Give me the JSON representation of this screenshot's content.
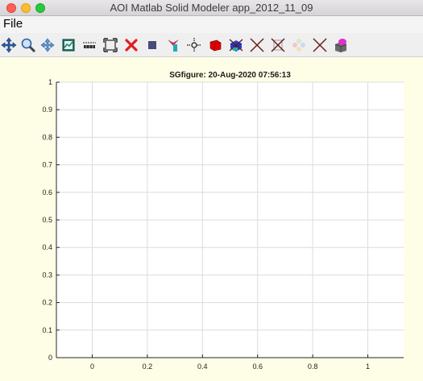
{
  "window": {
    "title": "AOI Matlab Solid Modeler app_2012_11_09"
  },
  "menu": {
    "file_label": "File"
  },
  "toolbar": {
    "tools": [
      {
        "name": "pan-arrows-icon"
      },
      {
        "name": "zoom-icon"
      },
      {
        "name": "move-icon"
      },
      {
        "name": "plot-icon"
      },
      {
        "name": "measure-icon"
      },
      {
        "name": "fit-view-icon"
      },
      {
        "name": "delete-icon"
      },
      {
        "name": "stop-icon"
      },
      {
        "name": "select-icon"
      },
      {
        "name": "crosshair-icon"
      },
      {
        "name": "red-solid-icon"
      },
      {
        "name": "blue-solid-icon"
      },
      {
        "name": "cross-tool-icon"
      },
      {
        "name": "crossed-frame-icon"
      },
      {
        "name": "dots-icon"
      },
      {
        "name": "cross-tool-2-icon"
      },
      {
        "name": "pink-solid-icon"
      }
    ]
  },
  "chart_data": {
    "type": "line",
    "title": "SGfigure: 20-Aug-2020 07:56:13",
    "xlim": [
      -0.13,
      1.13
    ],
    "ylim": [
      0,
      1
    ],
    "xticks": [
      "0",
      "0.2",
      "0.4",
      "0.6",
      "0.8",
      "1"
    ],
    "xtick_values": [
      0,
      0.2,
      0.4,
      0.6,
      0.8,
      1
    ],
    "yticks": [
      "0",
      "0.1",
      "0.2",
      "0.3",
      "0.4",
      "0.5",
      "0.6",
      "0.7",
      "0.8",
      "0.9",
      "1"
    ],
    "ytick_values": [
      0,
      0.1,
      0.2,
      0.3,
      0.4,
      0.5,
      0.6,
      0.7,
      0.8,
      0.9,
      1
    ],
    "grid": true,
    "series": []
  }
}
